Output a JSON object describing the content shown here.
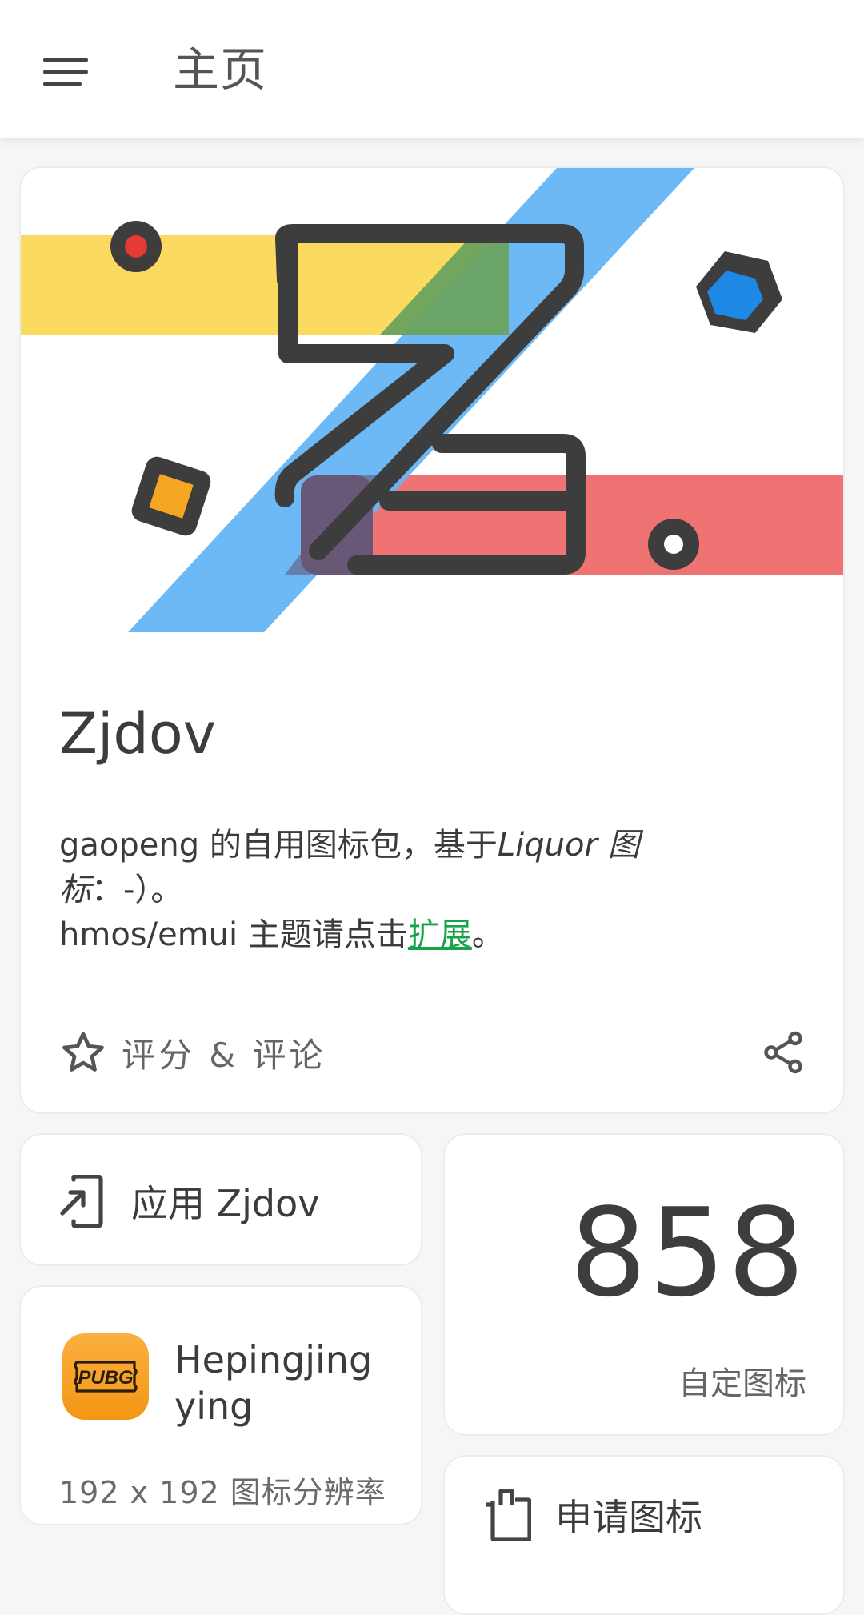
{
  "topbar": {
    "title": "主页",
    "menu_icon": "menu-icon"
  },
  "hero": {
    "app_name": "Zjdov",
    "desc_line1_a": "gaopeng 的自用图标包，基于",
    "desc_line1_italic": "Liquor 图标",
    "desc_line2_a": "：-）。",
    "desc_line3_a": "hmos/emui 主题请点击",
    "desc_link": "扩展",
    "desc_line3_b": "。",
    "rate_label": "评分 & 评论",
    "rate_icon": "star-outline-icon",
    "share_icon": "share-icon",
    "colors": {
      "yellow": "#fbdb5f",
      "blue": "#64b5f6",
      "red": "#ef7373",
      "dark": "#3d3d3d"
    }
  },
  "apply": {
    "label": "应用 Zjdov",
    "icon": "apply-phone-icon"
  },
  "icon_card": {
    "name": "Hepingjing ying",
    "resolution": "192 x 192 图标分辨率",
    "logo_text": "PUBG"
  },
  "count": {
    "value": "858",
    "label": "自定图标"
  },
  "request": {
    "label": "申请图标",
    "icon": "request-icon"
  }
}
